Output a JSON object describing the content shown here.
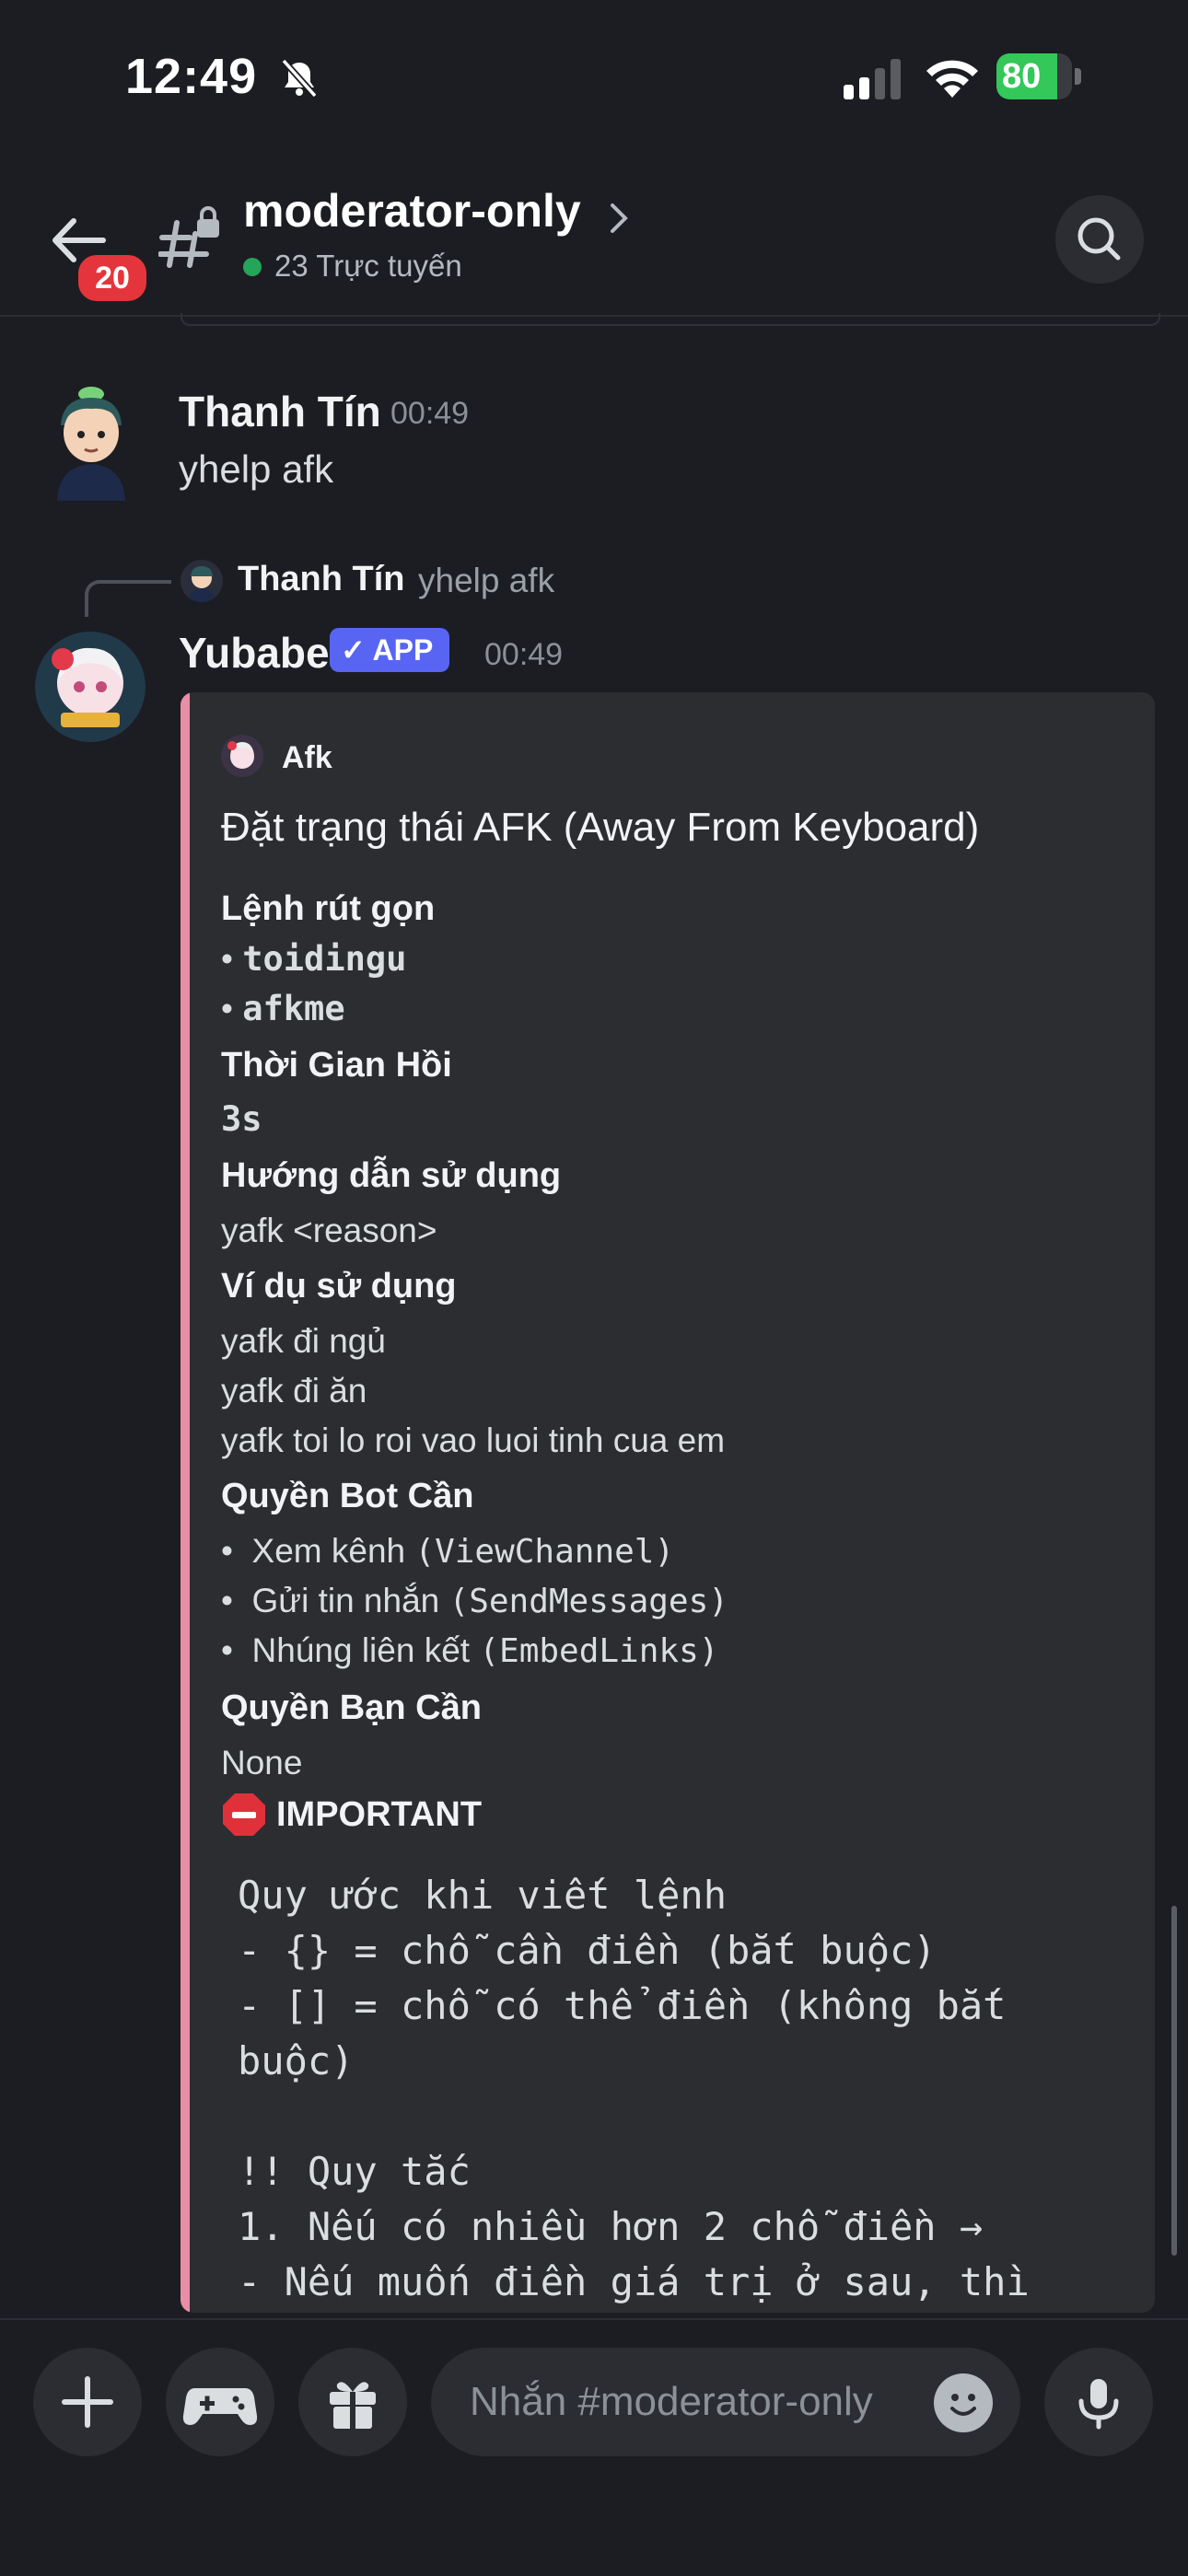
{
  "status_bar": {
    "time": "12:49",
    "battery": "80",
    "battery_level": 0.8
  },
  "header": {
    "back_badge": "20",
    "channel_name": "moderator-only",
    "online": "23 Trực tuyến"
  },
  "message1": {
    "author": "Thanh Tín",
    "time": "00:49",
    "text": "yhelp afk"
  },
  "reply": {
    "author": "Thanh Tín",
    "text": "yhelp afk"
  },
  "message2": {
    "author": "Yubabe",
    "badge": "✓ APP",
    "time": "00:49",
    "embed": {
      "author": "Afk",
      "title": "Đặt trạng thái AFK (Away From Keyboard)",
      "aliases_label": "Lệnh rút gọn",
      "aliases": [
        "toidingu",
        "afkme"
      ],
      "cooldown_label": "Thời Gian Hồi",
      "cooldown": "3s",
      "usage_label": "Hướng dẫn sử dụng",
      "usage": "yafk <reason>",
      "examples_label": "Ví dụ sử dụng",
      "examples": [
        "yafk đi ngủ",
        "yafk đi ăn",
        "yafk toi lo roi vao luoi tinh cua em"
      ],
      "bot_perms_label": "Quyền Bot Cần",
      "bot_perms": [
        {
          "text": "Xem kênh ",
          "code": "(ViewChannel)"
        },
        {
          "text": "Gửi tin nhắn ",
          "code": "(SendMessages)"
        },
        {
          "text": "Nhúng liên kết ",
          "code": "(EmbedLinks)"
        }
      ],
      "user_perms_label": "Quyền Bạn Cần",
      "user_perms": "None",
      "important_label": "IMPORTANT",
      "code_lines": [
        "Quy ước khi viết lệnh",
        "- {} = chỗ cần điền (bắt buộc)",
        "- [] = chỗ có thể điền (không bắt",
        "buộc)",
        "",
        "!! Quy tắc",
        "1. Nếu có nhiều hơn 2 chỗ điền →",
        "- Nếu muốn điền giá trị ở sau, thì"
      ]
    }
  },
  "composer": {
    "placeholder": "Nhắn #moderator-only"
  }
}
